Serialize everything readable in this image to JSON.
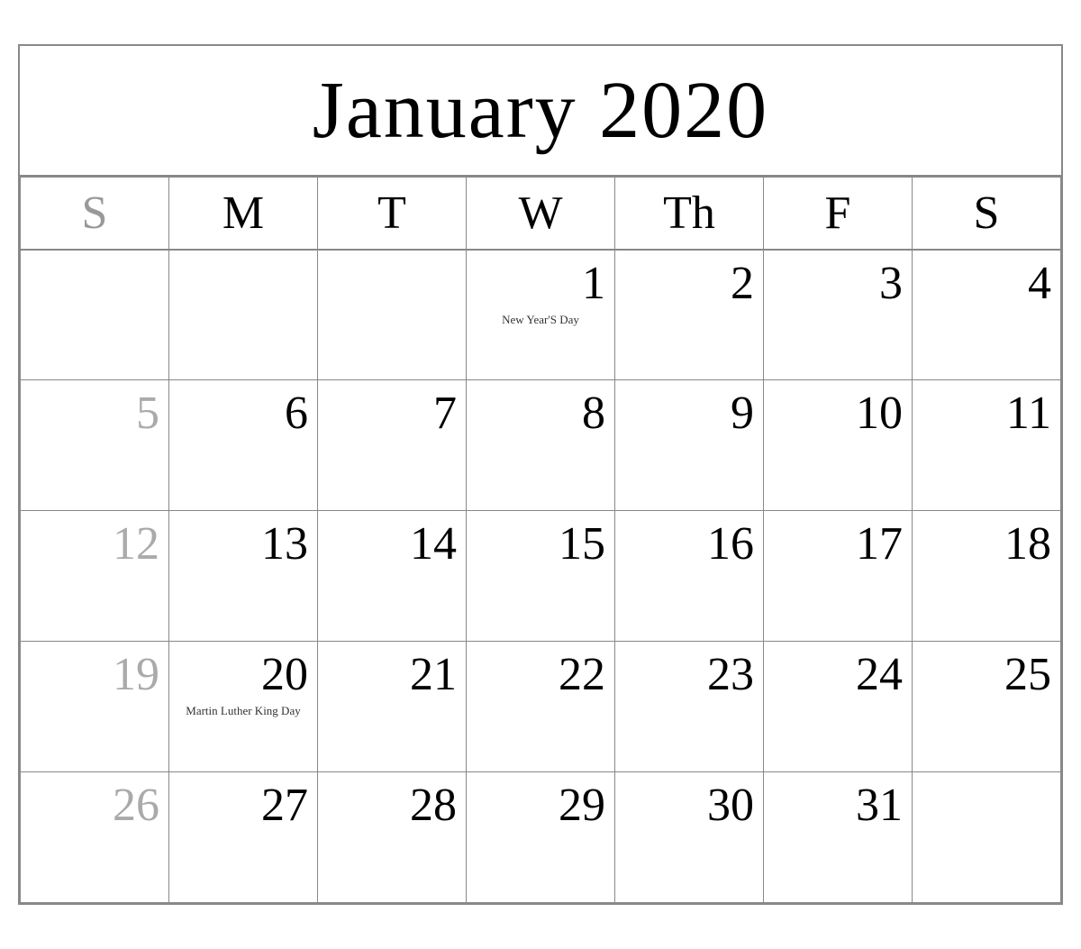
{
  "header": {
    "title": "January 2020"
  },
  "day_headers": [
    {
      "label": "S",
      "type": "sunday"
    },
    {
      "label": "M",
      "type": "regular"
    },
    {
      "label": "T",
      "type": "regular"
    },
    {
      "label": "W",
      "type": "regular"
    },
    {
      "label": "Th",
      "type": "regular"
    },
    {
      "label": "F",
      "type": "regular"
    },
    {
      "label": "S",
      "type": "saturday"
    }
  ],
  "weeks": [
    [
      {
        "day": "",
        "type": "empty"
      },
      {
        "day": "",
        "type": "empty"
      },
      {
        "day": "",
        "type": "empty"
      },
      {
        "day": "1",
        "type": "regular",
        "holiday": "New Year'S Day"
      },
      {
        "day": "2",
        "type": "regular"
      },
      {
        "day": "3",
        "type": "regular"
      },
      {
        "day": "4",
        "type": "regular"
      }
    ],
    [
      {
        "day": "5",
        "type": "sunday"
      },
      {
        "day": "6",
        "type": "regular"
      },
      {
        "day": "7",
        "type": "regular"
      },
      {
        "day": "8",
        "type": "regular"
      },
      {
        "day": "9",
        "type": "regular"
      },
      {
        "day": "10",
        "type": "regular"
      },
      {
        "day": "11",
        "type": "regular"
      }
    ],
    [
      {
        "day": "12",
        "type": "sunday"
      },
      {
        "day": "13",
        "type": "regular"
      },
      {
        "day": "14",
        "type": "regular"
      },
      {
        "day": "15",
        "type": "regular"
      },
      {
        "day": "16",
        "type": "regular"
      },
      {
        "day": "17",
        "type": "regular"
      },
      {
        "day": "18",
        "type": "regular"
      }
    ],
    [
      {
        "day": "19",
        "type": "sunday"
      },
      {
        "day": "20",
        "type": "regular",
        "holiday": "Martin Luther King Day"
      },
      {
        "day": "21",
        "type": "regular"
      },
      {
        "day": "22",
        "type": "regular"
      },
      {
        "day": "23",
        "type": "regular"
      },
      {
        "day": "24",
        "type": "regular"
      },
      {
        "day": "25",
        "type": "regular"
      }
    ],
    [
      {
        "day": "26",
        "type": "sunday"
      },
      {
        "day": "27",
        "type": "regular"
      },
      {
        "day": "28",
        "type": "regular"
      },
      {
        "day": "29",
        "type": "regular"
      },
      {
        "day": "30",
        "type": "regular"
      },
      {
        "day": "31",
        "type": "regular"
      },
      {
        "day": "",
        "type": "empty"
      }
    ]
  ]
}
